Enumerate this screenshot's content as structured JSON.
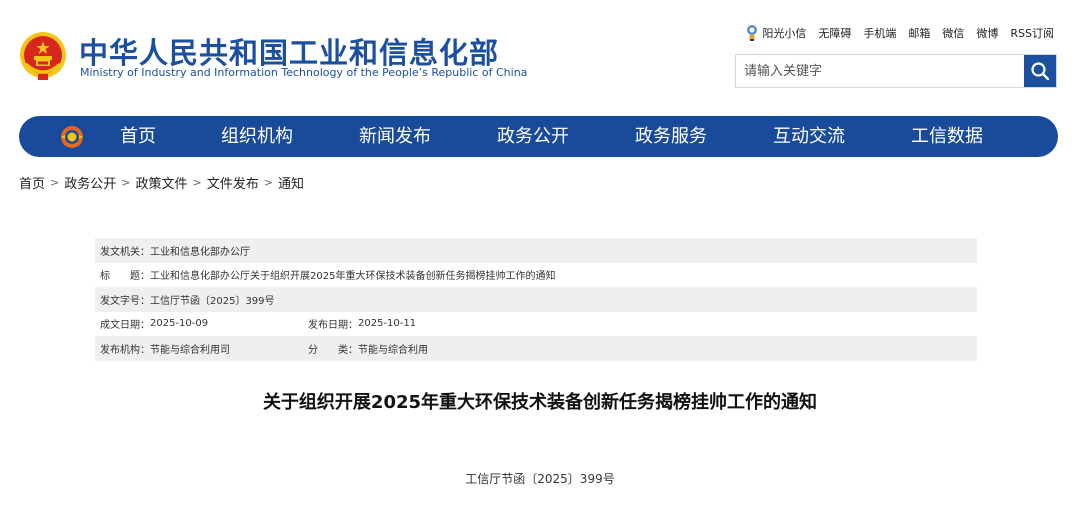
{
  "header": {
    "brand_cn": "中华人民共和国工业和信息化部",
    "brand_en": "Ministry of Industry and Information Technology of the People’s Republic of China",
    "top_links": [
      "阳光小信",
      "无障碍",
      "手机端",
      "邮箱",
      "微信",
      "微博",
      "RSS订阅"
    ],
    "search": {
      "placeholder": "请输入关键字"
    }
  },
  "nav": {
    "items": [
      "首页",
      "组织机构",
      "新闻发布",
      "政务公开",
      "政务服务",
      "互动交流",
      "工信数据"
    ]
  },
  "breadcrumb": {
    "items": [
      "首页",
      "政务公开",
      "政策文件",
      "文件发布",
      "通知"
    ],
    "separator": ">"
  },
  "meta": {
    "issuer_label": "发文机关：",
    "issuer": "工业和信息化部办公厅",
    "title_label": "标　　题：",
    "title": "工业和信息化部办公厅关于组织开展2025年重大环保技术装备创新任务揭榜挂帅工作的通知",
    "docno_label": "发文字号：",
    "docno": "工信厅节函〔2025〕399号",
    "made_label": "成文日期：",
    "made_date": "2025-10-09",
    "pub_label": "发布日期：",
    "pub_date": "2025-10-11",
    "org_label": "发布机构：",
    "org": "节能与综合利用司",
    "cat_label": "分　　类：",
    "category": "节能与综合利用"
  },
  "article": {
    "title": "关于组织开展2025年重大环保技术装备创新任务揭榜挂帅工作的通知",
    "doc_no": "工信厅节函〔2025〕399号"
  },
  "colors": {
    "brand_blue": "#1b4f9f",
    "nav_blue": "#1a4b9b",
    "row_shade": "#efefef",
    "emblem_red": "#d7261e",
    "emblem_gold": "#f5c518"
  }
}
